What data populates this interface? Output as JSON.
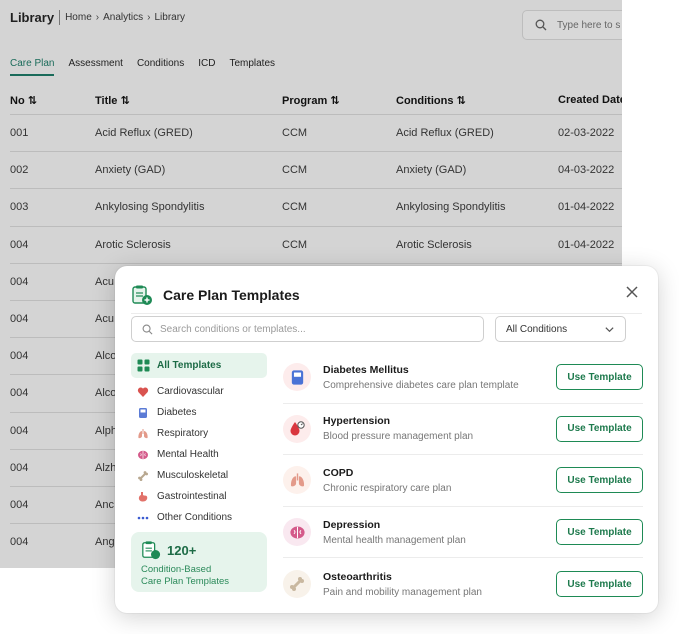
{
  "library": {
    "title": "Library",
    "breadcrumbs": [
      "Home",
      "Analytics",
      "Library"
    ],
    "search_placeholder": "Type here to s",
    "tabs": [
      "Care Plan",
      "Assessment",
      "Conditions",
      "ICD",
      "Templates"
    ],
    "active_tab": "Care Plan",
    "columns": [
      "No ⇅",
      "Title ⇅",
      "Program ⇅",
      "Conditions ⇅",
      "Created Date"
    ],
    "rows": [
      [
        "001",
        "Acid Reflux (GRED)",
        "CCM",
        "Acid Reflux (GRED)",
        "02-03-2022"
      ],
      [
        "002",
        "Anxiety (GAD)",
        "CCM",
        "Anxiety (GAD)",
        "04-03-2022"
      ],
      [
        "003",
        "Ankylosing Spondylitis",
        "CCM",
        "Ankylosing Spondylitis",
        "01-04-2022"
      ],
      [
        "004",
        "Arotic Sclerosis",
        "CCM",
        "Arotic Sclerosis",
        "01-04-2022"
      ],
      [
        "004",
        "Acu",
        "",
        "",
        ""
      ],
      [
        "004",
        "Acu",
        "",
        "",
        ""
      ],
      [
        "004",
        "Alco",
        "",
        "",
        ""
      ],
      [
        "004",
        "Alco",
        "",
        "",
        ""
      ],
      [
        "004",
        "Alph",
        "",
        "",
        ""
      ],
      [
        "004",
        "Alzh",
        "",
        "",
        ""
      ],
      [
        "004",
        "Anc",
        "",
        "",
        ""
      ],
      [
        "004",
        "Ang",
        "",
        "",
        ""
      ]
    ]
  },
  "modal": {
    "title": "Care Plan Templates",
    "search_placeholder": "Search conditions or templates...",
    "filter_value": "All Conditions",
    "categories": [
      {
        "label": "All Templates",
        "icon": "grid-icon",
        "color": "#1e8a55"
      },
      {
        "label": "Cardiovascular",
        "icon": "heart-icon",
        "color": "#d9534f"
      },
      {
        "label": "Diabetes",
        "icon": "glucose-meter-icon",
        "color": "#5b7bd5"
      },
      {
        "label": "Respiratory",
        "icon": "lungs-icon",
        "color": "#e39a8a"
      },
      {
        "label": "Mental Health",
        "icon": "brain-icon",
        "color": "#d45a8a"
      },
      {
        "label": "Musculoskeletal",
        "icon": "bone-icon",
        "color": "#b8a890"
      },
      {
        "label": "Gastrointestinal",
        "icon": "stomach-icon",
        "color": "#e2726a"
      },
      {
        "label": "Other Conditions",
        "icon": "more-icon",
        "color": "#3a5bd0"
      }
    ],
    "promo": {
      "count": "120+",
      "line1": "Condition-Based",
      "line2": "Care Plan Templates"
    },
    "templates": [
      {
        "name": "Diabetes Mellitus",
        "desc": "Comprehensive diabetes care plan template",
        "icon": "glucose-meter-icon",
        "button": "Use Template"
      },
      {
        "name": "Hypertension",
        "desc": "Blood pressure management plan",
        "icon": "blood-pressure-icon",
        "button": "Use Template"
      },
      {
        "name": "COPD",
        "desc": "Chronic respiratory care plan",
        "icon": "lungs-icon",
        "button": "Use Template"
      },
      {
        "name": "Depression",
        "desc": "Mental health management plan",
        "icon": "brain-icon",
        "button": "Use Template"
      },
      {
        "name": "Osteoarthritis",
        "desc": "Pain and mobility management plan",
        "icon": "bone-joint-icon",
        "button": "Use Template"
      }
    ],
    "colors": {
      "accent": "#1e8a55",
      "accent_bg": "#e6f4ec"
    }
  }
}
